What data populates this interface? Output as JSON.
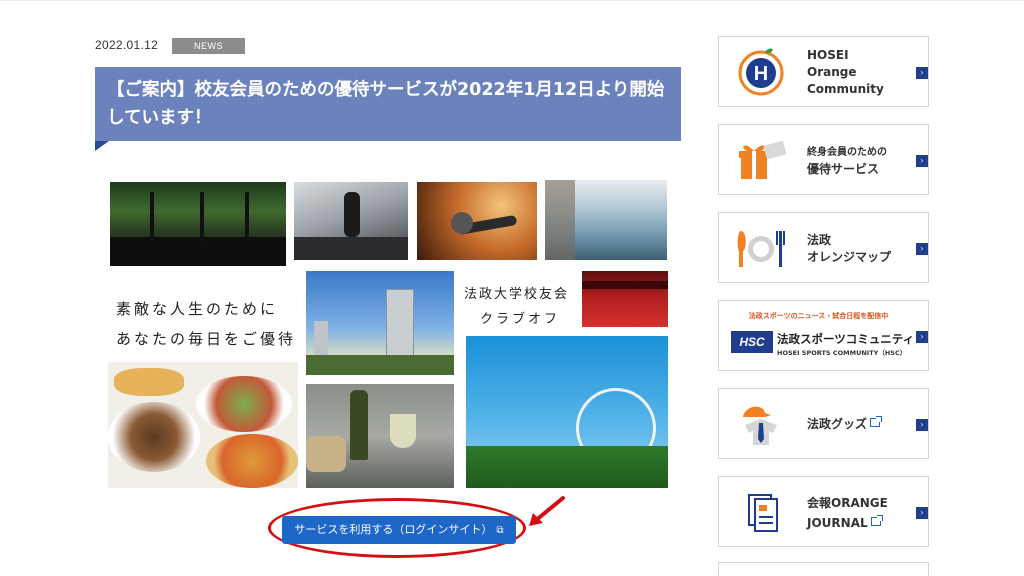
{
  "article": {
    "date": "2022.01.12",
    "tag": "NEWS",
    "title": "【ご案内】校友会員のための優待サービスが2022年1月12日より開始しています！"
  },
  "collage": {
    "tagline_line1": "素敵な人生のために",
    "tagline_line2": "あなたの毎日をご優待",
    "club_line1": "法政大学校友会",
    "club_line2": "クラブオフ"
  },
  "login_button": {
    "label": "サービスを利用する（ログインサイト）"
  },
  "sidebar": {
    "items": [
      {
        "label": "HOSEI\nOrange\nCommunity",
        "icon": "hosei-h-logo-icon"
      },
      {
        "label_small": "終身会員のための",
        "label": "優待サービス",
        "icon": "gift-icon"
      },
      {
        "label": "法政\nオレンジマップ",
        "icon": "cutlery-icon"
      },
      {
        "banner_top": "法政スポーツのニュース・試合日程を配信中",
        "label": "法政スポーツコミュニティ",
        "sub": "HOSEI SPORTS COMMUNITY（HSC）",
        "logo": "HSC",
        "icon": "hsc-logo-icon"
      },
      {
        "label": "法政グッズ",
        "icon": "goods-cap-shirt-icon"
      },
      {
        "label_line1": "会報ORANGE",
        "label_line2": "JOURNAL",
        "icon": "journal-document-icon"
      }
    ]
  },
  "colors": {
    "title_bg": "#6b82bd",
    "accent_orange": "#f08224",
    "navy": "#1e3d8f",
    "button_blue": "#1f66c9",
    "highlight_red": "#d40f14"
  }
}
